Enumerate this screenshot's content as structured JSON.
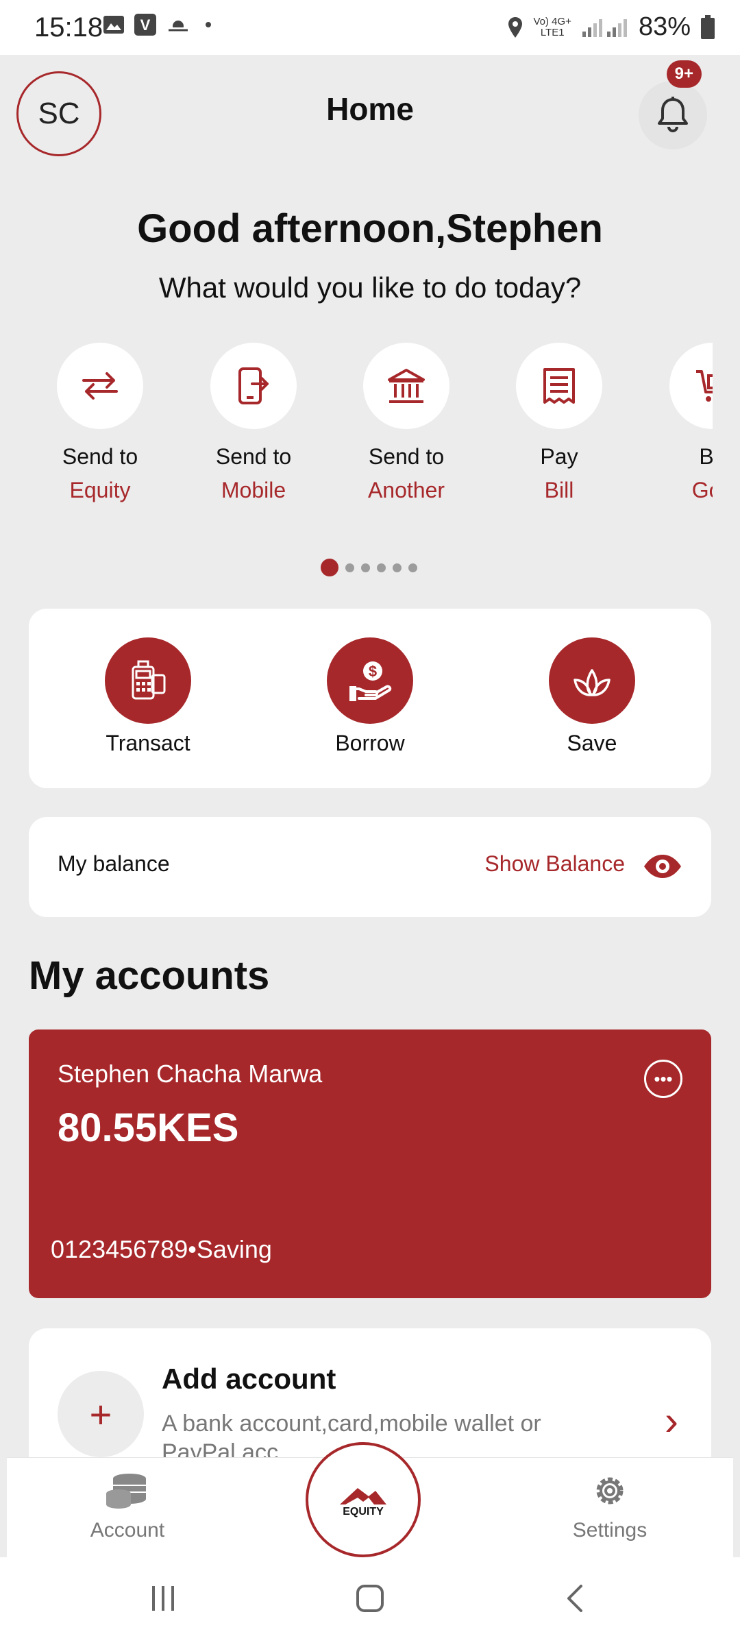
{
  "status_bar": {
    "time": "15:18",
    "network_top": "Vo) 4G+",
    "network_bottom": "LTE1",
    "battery": "83%"
  },
  "header": {
    "avatar_initials": "SC",
    "title": "Home",
    "notification_badge": "9+"
  },
  "greeting": {
    "title": "Good afternoon,Stephen",
    "subtitle": "What would you like to do today?"
  },
  "quick_actions": [
    {
      "line1": "Send to",
      "line2": "Equity",
      "icon": "transfer-arrows-icon"
    },
    {
      "line1": "Send to",
      "line2": "Mobile",
      "icon": "mobile-send-icon"
    },
    {
      "line1": "Send to",
      "line2": "Another",
      "icon": "bank-icon"
    },
    {
      "line1": "Pay",
      "line2": "Bill",
      "icon": "bill-icon"
    },
    {
      "line1": "Bu",
      "line2": "Goo",
      "icon": "cart-icon"
    }
  ],
  "carousel": {
    "pages": 6,
    "active": 0
  },
  "main_actions": [
    {
      "label": "Transact",
      "icon": "pos-terminal-icon"
    },
    {
      "label": "Borrow",
      "icon": "hand-money-icon"
    },
    {
      "label": "Save",
      "icon": "plant-icon"
    }
  ],
  "balance": {
    "label": "My balance",
    "show_label": "Show Balance"
  },
  "accounts": {
    "section_title": "My accounts",
    "card": {
      "holder": "Stephen Chacha Marwa",
      "amount": "80.55KES",
      "number_line": "0123456789•Saving"
    },
    "add": {
      "title": "Add account",
      "description": "A bank account,card,mobile wallet or PayPal acc"
    }
  },
  "bottom_nav": {
    "left_label": "Account",
    "center_label": "EQUITY",
    "right_label": "Settings"
  },
  "colors": {
    "accent": "#a7282b",
    "background": "#ececec"
  }
}
